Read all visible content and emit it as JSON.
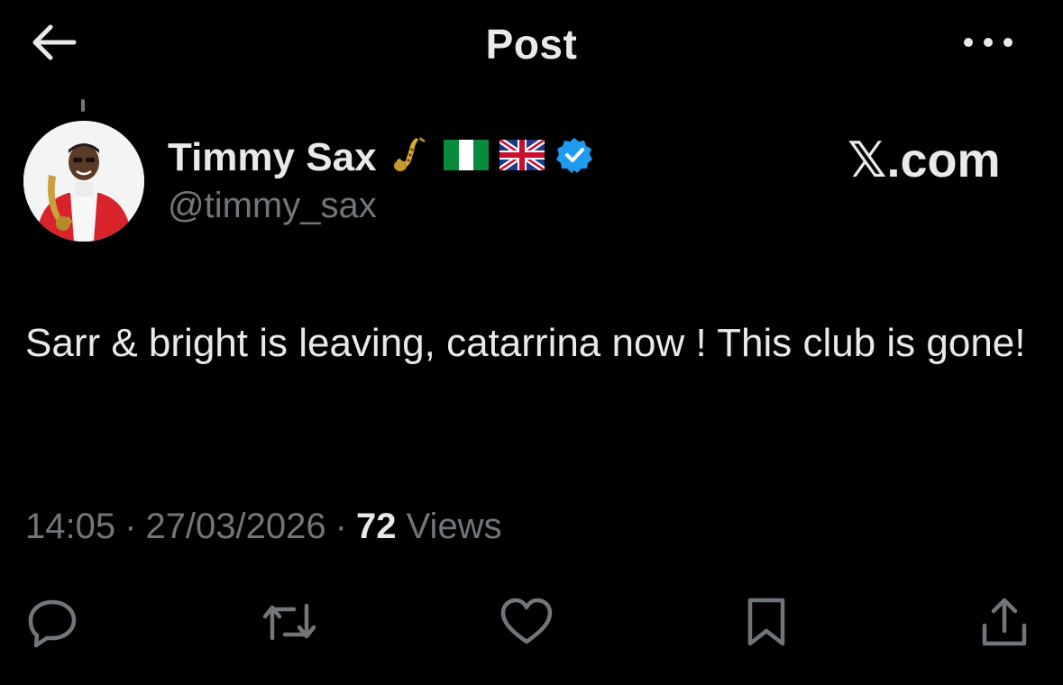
{
  "header": {
    "title": "Post",
    "back_icon": "back-arrow-icon",
    "more_icon": "more-dots-icon"
  },
  "author": {
    "display_name": "Timmy Sax",
    "handle": "@timmy_sax",
    "badges": [
      "saxophone-icon",
      "nigeria-flag-icon",
      "uk-flag-icon",
      "verified-badge-icon"
    ],
    "verified_color": "#1d9bf0"
  },
  "watermark": {
    "x_glyph": "𝕏",
    "domain": ".com"
  },
  "post": {
    "text": "Sarr & bright is leaving, catarrina now ! This club is gone!"
  },
  "meta": {
    "time": "14:05",
    "separator": "·",
    "date": "27/03/2026",
    "views_count": "72",
    "views_label": "Views"
  },
  "actions": [
    {
      "icon": "reply-icon"
    },
    {
      "icon": "repost-icon"
    },
    {
      "icon": "like-icon"
    },
    {
      "icon": "bookmark-icon"
    },
    {
      "icon": "share-icon"
    }
  ],
  "colors": {
    "background": "#000000",
    "text_primary": "#e7e9ea",
    "text_secondary": "#71767b",
    "icon": "#71767b"
  }
}
